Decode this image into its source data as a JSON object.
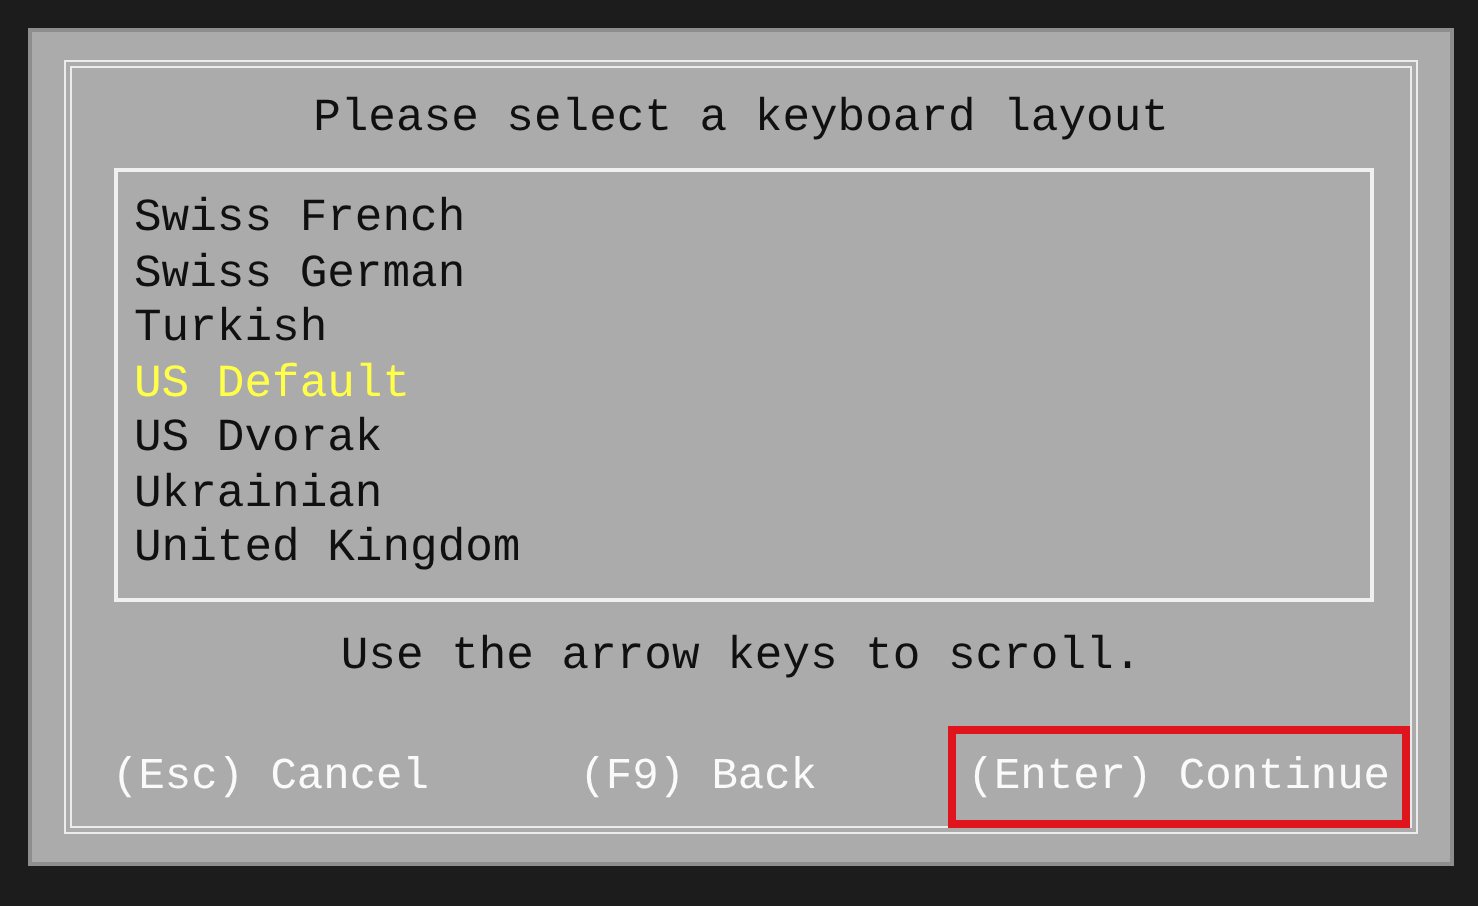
{
  "dialog": {
    "title": "Please select a keyboard layout"
  },
  "layouts": [
    {
      "label": "Swiss French",
      "selected": false
    },
    {
      "label": "Swiss German",
      "selected": false
    },
    {
      "label": "Turkish",
      "selected": false
    },
    {
      "label": "US Default",
      "selected": true
    },
    {
      "label": "US Dvorak",
      "selected": false
    },
    {
      "label": "Ukrainian",
      "selected": false
    },
    {
      "label": "United Kingdom",
      "selected": false
    }
  ],
  "hint": "Use the arrow keys to scroll.",
  "buttons": [
    {
      "label": "(Esc) Cancel",
      "highlighted": false
    },
    {
      "label": "(F9) Back",
      "highlighted": false
    },
    {
      "label": "(Enter) Continue",
      "highlighted": true
    }
  ]
}
